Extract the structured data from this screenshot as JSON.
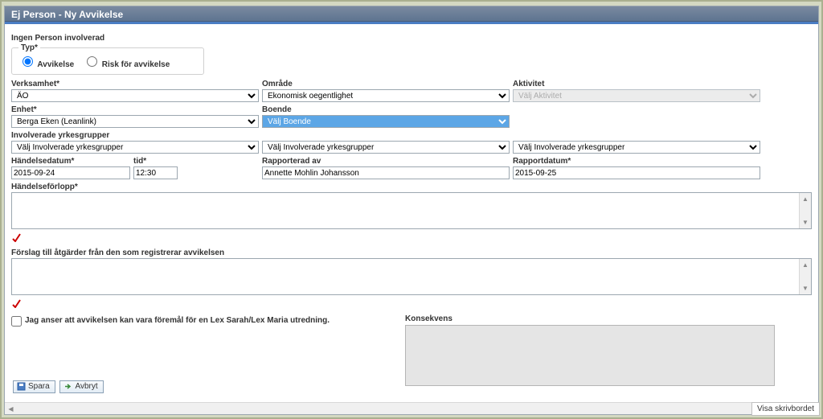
{
  "title": "Ej Person - Ny Avvikelse",
  "heading": "Ingen Person involverad",
  "typ": {
    "legend": "Typ*",
    "options": {
      "avvikelse": "Avvikelse",
      "risk": "Risk för avvikelse"
    }
  },
  "labels": {
    "verksamhet": "Verksamhet*",
    "enhet": "Enhet*",
    "yrkesgrupper": "Involverade yrkesgrupper",
    "omrade": "Område",
    "boende": "Boende",
    "aktivitet": "Aktivitet",
    "handelsedatum": "Händelsedatum*",
    "tid": "tid*",
    "rapporterad_av": "Rapporterad av",
    "rapportdatum": "Rapportdatum*",
    "handelseforlopp": "Händelseförlopp*",
    "forslag": "Förslag till åtgärder från den som registrerar avvikelsen",
    "konsekvens": "Konsekvens"
  },
  "values": {
    "verksamhet": "ÄO",
    "enhet": "Berga Eken (Leanlink)",
    "yrkesgrupper": "Välj Involverade yrkesgrupper",
    "omrade": "Ekonomisk oegentlighet",
    "boende": "Välj Boende",
    "aktivitet": "Välj Aktivitet",
    "yrkesgrupper2": "Välj Involverade yrkesgrupper",
    "yrkesgrupper3": "Välj Involverade yrkesgrupper",
    "handelsedatum": "2015-09-24",
    "tid": "12:30",
    "rapporterad_av": "Annette Mohlin Johansson",
    "rapportdatum": "2015-09-25"
  },
  "checkbox_text": "Jag anser att avvikelsen kan vara föremål för en Lex Sarah/Lex Maria utredning.",
  "buttons": {
    "spara": "Spara",
    "avbryt": "Avbryt"
  },
  "desktop_button": "Visa skrivbordet"
}
